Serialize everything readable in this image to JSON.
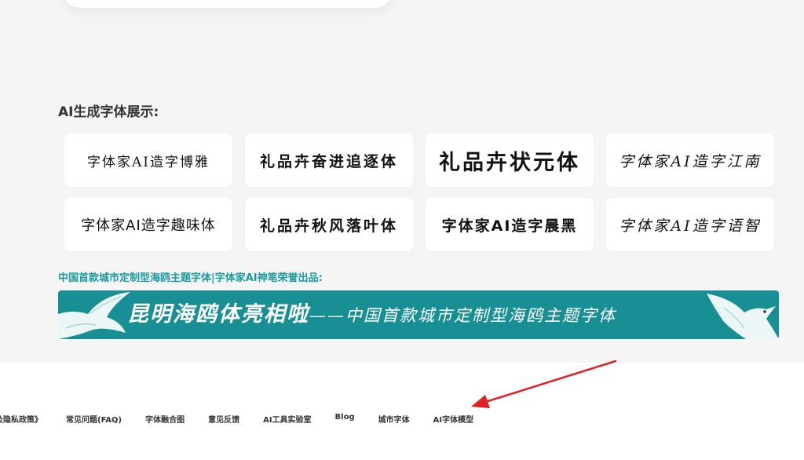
{
  "section": {
    "title": "AI生成字体展示:"
  },
  "font_samples": [
    "字体家AI造字博雅",
    "礼品卉奋进追逐体",
    "礼品卉状元体",
    "字体家AI造字江南",
    "字体家AI造字趣味体",
    "礼品卉秋风落叶体",
    "字体家AI造字晨黑",
    "字体家AI造字语智"
  ],
  "promo": {
    "title": "中国首款城市定制型海鸥主题字体|字体家AI神笔荣誉出品:",
    "banner_main": "昆明海鸥体亮相啦",
    "banner_dash": "——",
    "banner_sub": "中国首款城市定制型海鸥主题字体",
    "banner_color": "#178f94"
  },
  "footer": {
    "links": [
      "及隐私政策》",
      "常见问题(FAQ)",
      "字体融合图",
      "意见反馈",
      "AI工具实验室",
      "Blog",
      "城市字体",
      "AI字体模型"
    ]
  },
  "annotation": {
    "arrow_color": "#e02020"
  }
}
